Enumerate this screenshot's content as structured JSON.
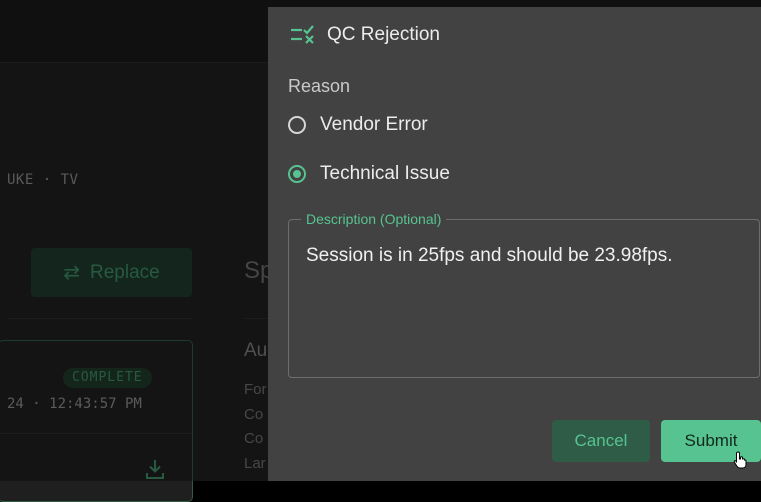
{
  "background": {
    "meta_text": "UKE · TV",
    "replace_button": {
      "label": "Replace",
      "icon": "swap-arrows-icon"
    },
    "card": {
      "status_badge": "COMPLETE",
      "timestamp": "24 · 12:43:57 PM",
      "download_icon": "download-icon"
    },
    "spec_heading": "Sp",
    "spec_sub": "Au",
    "spec_lines": [
      "For",
      "Co",
      "Co",
      "Lar"
    ]
  },
  "dialog": {
    "header_icon": "checklist-reject-icon",
    "title": "QC Rejection",
    "reason_label": "Reason",
    "options": [
      {
        "label": "Vendor Error",
        "checked": false
      },
      {
        "label": "Technical Issue",
        "checked": true
      }
    ],
    "description": {
      "legend": "Description (Optional)",
      "value": "Session is in 25fps and should be 23.98fps."
    },
    "cancel_label": "Cancel",
    "submit_label": "Submit"
  },
  "colors": {
    "accent": "#57c390",
    "dialog_bg": "#424242",
    "cancel_bg": "#2e5c47"
  }
}
